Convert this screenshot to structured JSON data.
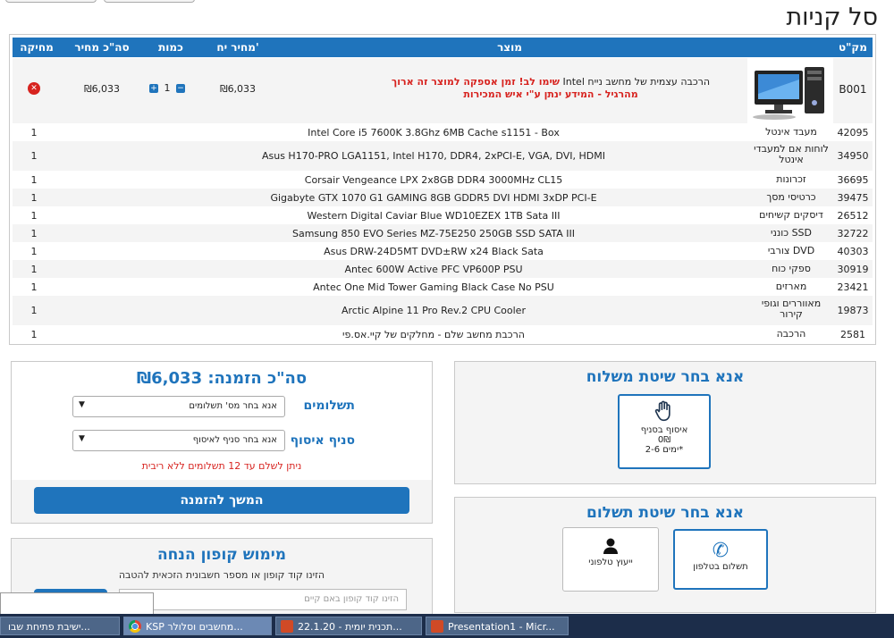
{
  "page_title": "סל קניות",
  "cart": {
    "headers": {
      "sku": "מק\"ט",
      "product": "מוצר",
      "unit_price": "מחיר יח'",
      "qty": "כמות",
      "total": "סה\"כ מחיר",
      "delete": "מחיקה"
    },
    "main": {
      "sku": "B001",
      "name": "הרכבה עצמית של מחשב נייח Intel",
      "warning": "שימו לב! זמן אספקה למוצר זה ארוך מהרגיל - המידע ינתן ע\"י איש המכירות",
      "price": "₪6,033",
      "qty": "1",
      "total": "₪6,033",
      "plus": "+",
      "minus": "−",
      "delete_glyph": "✕"
    },
    "rows": [
      {
        "sku": "42095",
        "cat": "מעבד אינטל",
        "name": "Intel Core i5 7600K 3.8Ghz 6MB Cache s1151 - Box",
        "qty": "1"
      },
      {
        "sku": "34950",
        "cat": "לוחות אם למעבדי אינטל",
        "name": "Asus H170-PRO LGA1151, Intel H170, DDR4, 2xPCI-E, VGA, DVI, HDMI",
        "qty": "1"
      },
      {
        "sku": "36695",
        "cat": "זכרונות",
        "name": "Corsair Vengeance LPX 2x8GB DDR4 3000MHz CL15",
        "qty": "1"
      },
      {
        "sku": "39475",
        "cat": "כרטיסי מסך",
        "name": "Gigabyte GTX 1070 G1 GAMING 8GB GDDR5 DVI HDMI 3xDP PCI-E",
        "qty": "1"
      },
      {
        "sku": "26512",
        "cat": "דיסקים קשיחים",
        "name": "Western Digital Caviar Blue WD10EZEX 1TB Sata III",
        "qty": "1"
      },
      {
        "sku": "32722",
        "cat": "כונני SSD",
        "name": "Samsung 850 EVO Series MZ-75E250 250GB SSD SATA III",
        "qty": "1"
      },
      {
        "sku": "40303",
        "cat": "צורבי DVD",
        "name": "Asus DRW-24D5MT DVD±RW x24 Black Sata",
        "qty": "1"
      },
      {
        "sku": "30919",
        "cat": "ספקי כוח",
        "name": "Antec 600W Active PFC VP600P PSU",
        "qty": "1"
      },
      {
        "sku": "23421",
        "cat": "מארזים",
        "name": "Antec One Mid Tower Gaming Black Case No PSU",
        "qty": "1"
      },
      {
        "sku": "19873",
        "cat": "מאווררים וגופי קירור",
        "name": "Arctic Alpine 11 Pro Rev.2 CPU Cooler",
        "qty": "1"
      },
      {
        "sku": "2581",
        "cat": "הרכבה",
        "name": "הרכבת מחשב שלם - מחלקים של קיי.אס.פי",
        "qty": "1"
      }
    ]
  },
  "order": {
    "total_label": "סה\"כ הזמנה: ₪6,033",
    "payments_label": "תשלומים",
    "payments_value": "אנא בחר מס' תשלומים",
    "branch_label": "סניף איסוף",
    "branch_value": "אנא בחר סניף לאיסוף",
    "arrow": "▼",
    "note": "ניתן לשלם עד 12 תשלומים ללא ריבית",
    "continue_label": "המשך להזמנה"
  },
  "coupon": {
    "title": "מימוש קופון הנחה",
    "subtitle": "הזינו קוד קופון או מספר חשבונית הזכאית להטבה",
    "placeholder": "הזינו קוד קופון באם קיים"
  },
  "shipping": {
    "title": "אנא בחר שיטת משלוח",
    "option_label": "איסוף בסניף",
    "option_price": "0₪",
    "option_time": "2-6 ימים*"
  },
  "payment": {
    "title": "אנא בחר שיטת תשלום",
    "phone_label": "תשלום בטלפון",
    "consult_label": "ייעוץ טלפוני"
  },
  "taskbar": {
    "items": [
      "ישיבת פתיחת שבו...",
      "KSP מחשבים וסלולר...",
      "22.1.20 - תכנית יומית...",
      "Presentation1 - Micr..."
    ]
  },
  "colors": {
    "accent": "#1f74bc",
    "warning": "#d7231f"
  }
}
